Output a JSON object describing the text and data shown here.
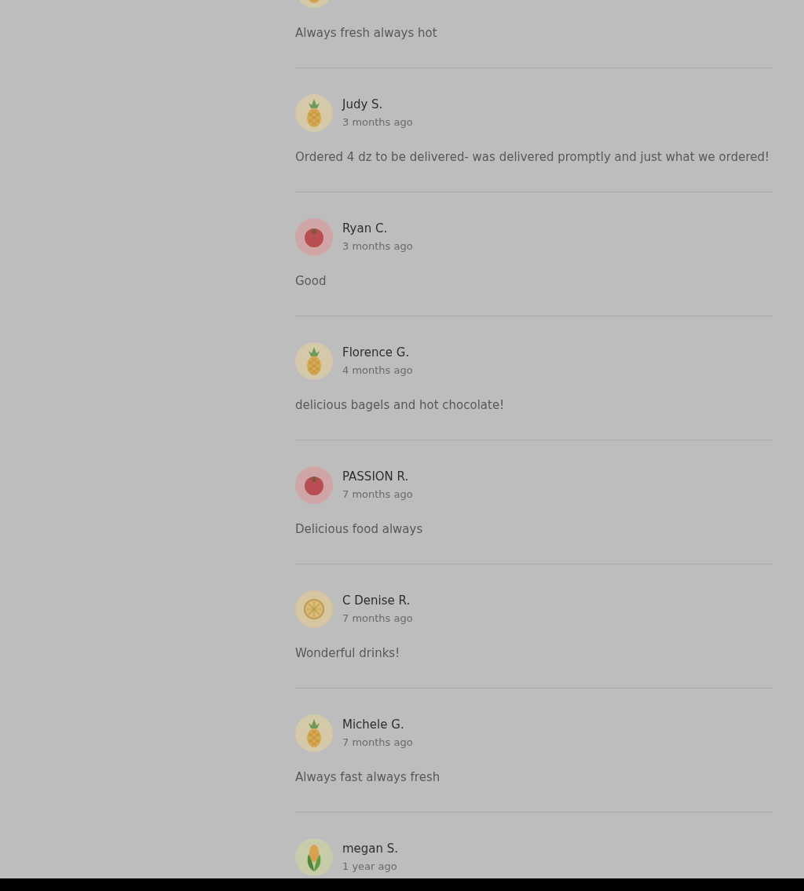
{
  "reviews": [
    {
      "kind": "pineapple",
      "text": "Always fresh always hot"
    },
    {
      "kind": "pineapple",
      "name": "Judy S.",
      "date": "3 months ago",
      "text": "Ordered 4 dz to be delivered- was delivered promptly and just what we ordered!"
    },
    {
      "kind": "tomato",
      "name": "Ryan C.",
      "date": "3 months ago",
      "text": "Good"
    },
    {
      "kind": "pineapple",
      "name": "Florence G.",
      "date": "4 months ago",
      "text": "delicious bagels and hot chocolate!"
    },
    {
      "kind": "tomato",
      "name": "PASSION R.",
      "date": "7 months ago",
      "text": "Delicious food always"
    },
    {
      "kind": "lemon",
      "name": "C Denise R.",
      "date": "7 months ago",
      "text": "Wonderful drinks!"
    },
    {
      "kind": "pineapple",
      "name": "Michele G.",
      "date": "7 months ago",
      "text": "Always fast always fresh"
    },
    {
      "kind": "corn",
      "name": "megan S.",
      "date": "1 year ago"
    }
  ]
}
